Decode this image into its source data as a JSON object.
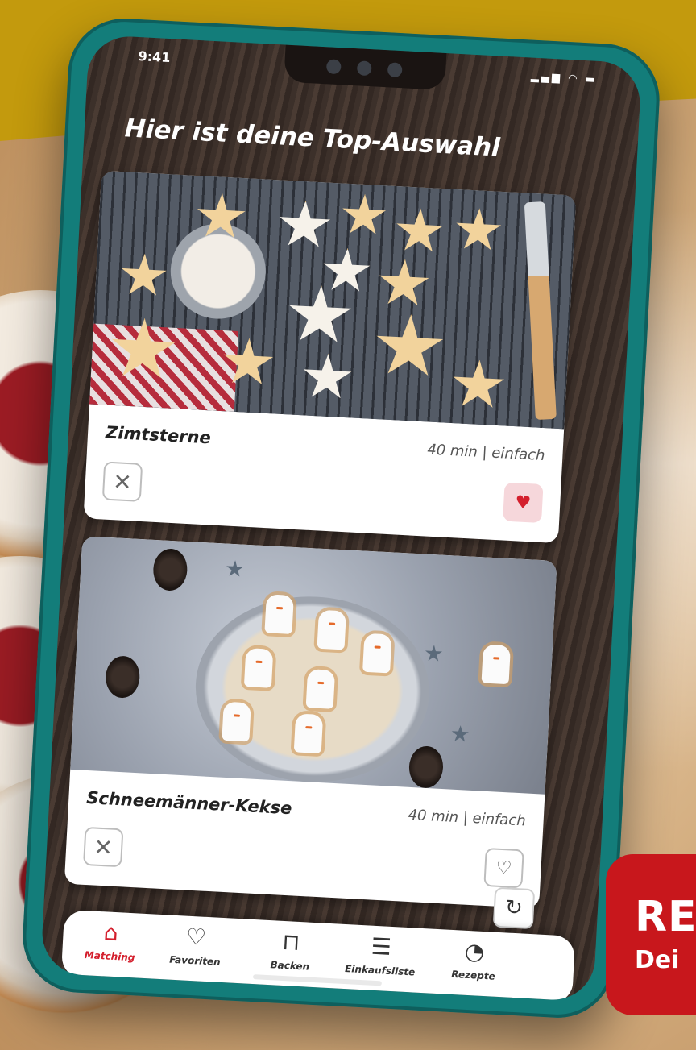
{
  "status_bar": {
    "time": "9:41",
    "icons": "signal-icon wifi-icon battery-icon"
  },
  "screen_title": "Hier ist deine Top-Auswahl",
  "recipes": [
    {
      "title": "Zimtsterne",
      "meta": "40 min | einfach",
      "favorited": true
    },
    {
      "title": "Schneemänner-Kekse",
      "meta": "40 min | einfach",
      "favorited": false
    }
  ],
  "tabbar": {
    "items": [
      {
        "label": "Matching",
        "icon": "home-icon",
        "active": true
      },
      {
        "label": "Favoriten",
        "icon": "heart-icon",
        "active": false
      },
      {
        "label": "Backen",
        "icon": "bookmark-icon",
        "active": false
      },
      {
        "label": "Einkaufsliste",
        "icon": "list-icon",
        "active": false
      },
      {
        "label": "Rezepte",
        "icon": "cookie-icon",
        "active": false
      }
    ]
  },
  "brand": {
    "name": "RE",
    "sub": "Dei"
  },
  "colors": {
    "accent": "#d41f2d",
    "phone_frame": "#137d7a",
    "gold_band": "#c39a0d",
    "brand_badge": "#c8171c"
  }
}
